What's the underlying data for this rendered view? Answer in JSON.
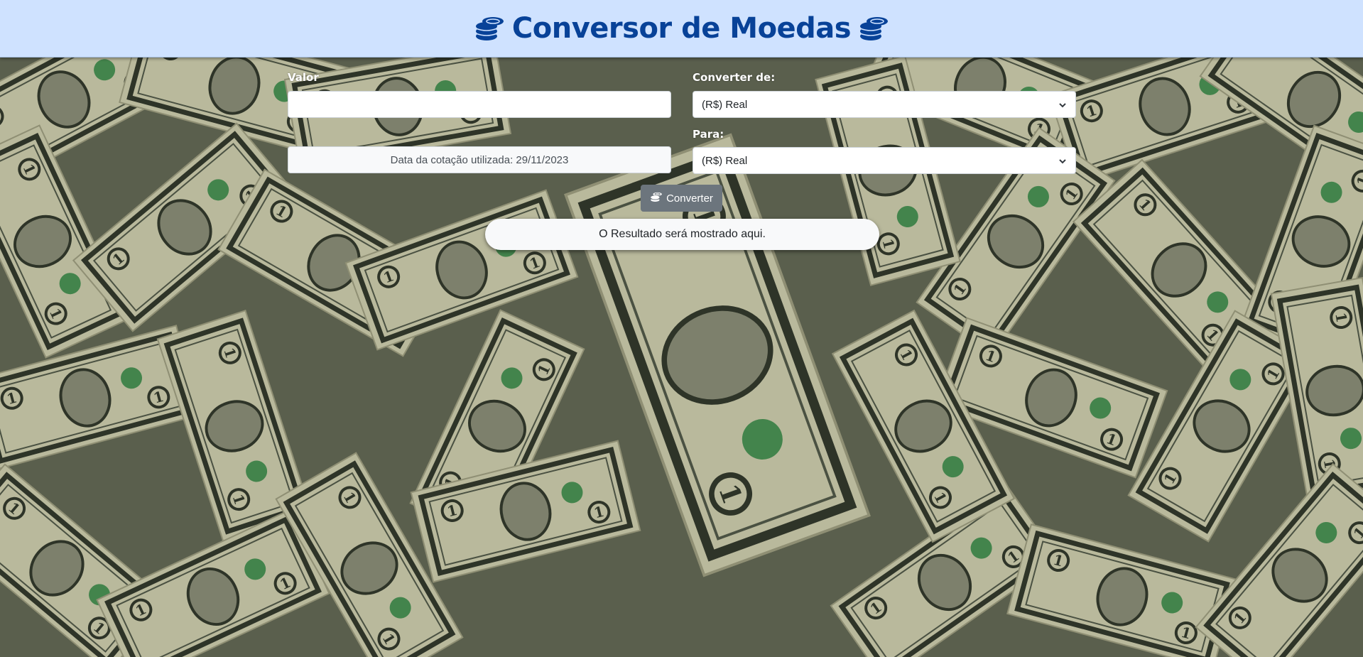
{
  "header": {
    "title": "Conversor de Moedas",
    "left_icon": "coins-icon",
    "right_icon": "coins-icon"
  },
  "form": {
    "amount": {
      "label": "Valor",
      "value": "",
      "placeholder": ""
    },
    "from": {
      "label": "Converter de:",
      "selected": "(R$) Real"
    },
    "to": {
      "label": "Para:",
      "selected": "(R$) Real"
    },
    "quote_date": "Data da cotação utilizada: 29/11/2023",
    "convert_button": {
      "label": "Converter",
      "icon": "coins-icon"
    },
    "result": "O Resultado será mostrado aqui."
  },
  "background": {
    "image": "pile of one-dollar bills"
  },
  "colors": {
    "header_bg": "#cfe2ff",
    "title": "#084298",
    "button_bg": "#6c757d",
    "bill_paper": "#b7b79a",
    "bill_ink": "#2c3226",
    "seal_green": "#1f7a3a"
  }
}
